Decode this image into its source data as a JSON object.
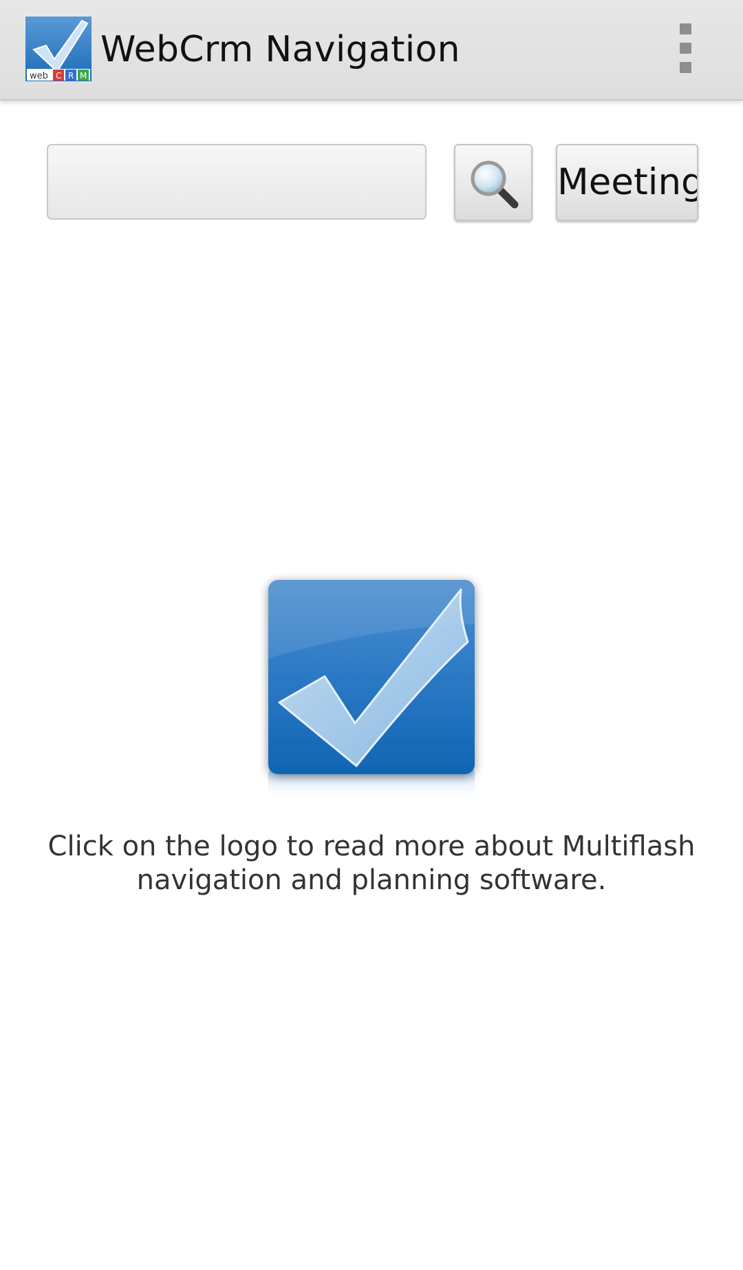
{
  "app": {
    "title": "WebCrm Navigation",
    "icon": "webcrm-logo-icon",
    "icon_label_web": "web",
    "icon_label_c": "C",
    "icon_label_r": "R",
    "icon_label_m": "M",
    "overflow_icon": "overflow-menu-icon"
  },
  "toolbar": {
    "search_value": "",
    "search_placeholder": "",
    "search_button_icon": "magnifier-icon",
    "meeting_label": "Meeting"
  },
  "main": {
    "logo_icon": "multiflash-checkmark-logo",
    "info_line1": "Click on the logo to read more about Multiflash",
    "info_line2": "navigation and planning software."
  },
  "colors": {
    "action_bar_bg": "#dedede",
    "logo_blue": "#1a6fbe",
    "text": "#333333"
  }
}
